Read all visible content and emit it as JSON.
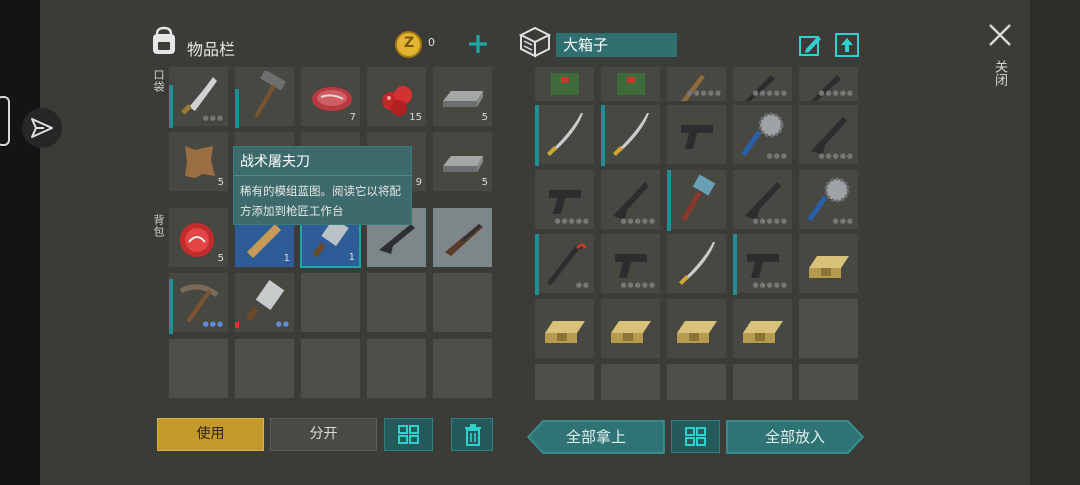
{
  "inventory": {
    "title": "物品栏",
    "coins": "0",
    "pocket_label": "口袋",
    "backpack_label": "背包",
    "counts": {
      "meat": "7",
      "berries": "15",
      "ingot1": "5",
      "hide": "5",
      "slot_hidden": "9",
      "ingot2": "5",
      "bottlecap": "5",
      "blueprint1": "1",
      "blueprint2": "1"
    }
  },
  "tooltip": {
    "title": "战术屠夫刀",
    "body": "稀有的模组蓝图。阅读它以将配方添加到枪匠工作台"
  },
  "buttons": {
    "use": "使用",
    "split": "分开"
  },
  "container": {
    "name": "大箱子",
    "take_all": "全部拿上",
    "put_all": "全部放入"
  },
  "close_label": "关闭",
  "colors": {
    "accent_teal": "#1f8f93",
    "use_gold": "#c29a2c",
    "panel_bg": "#3b3b37"
  }
}
